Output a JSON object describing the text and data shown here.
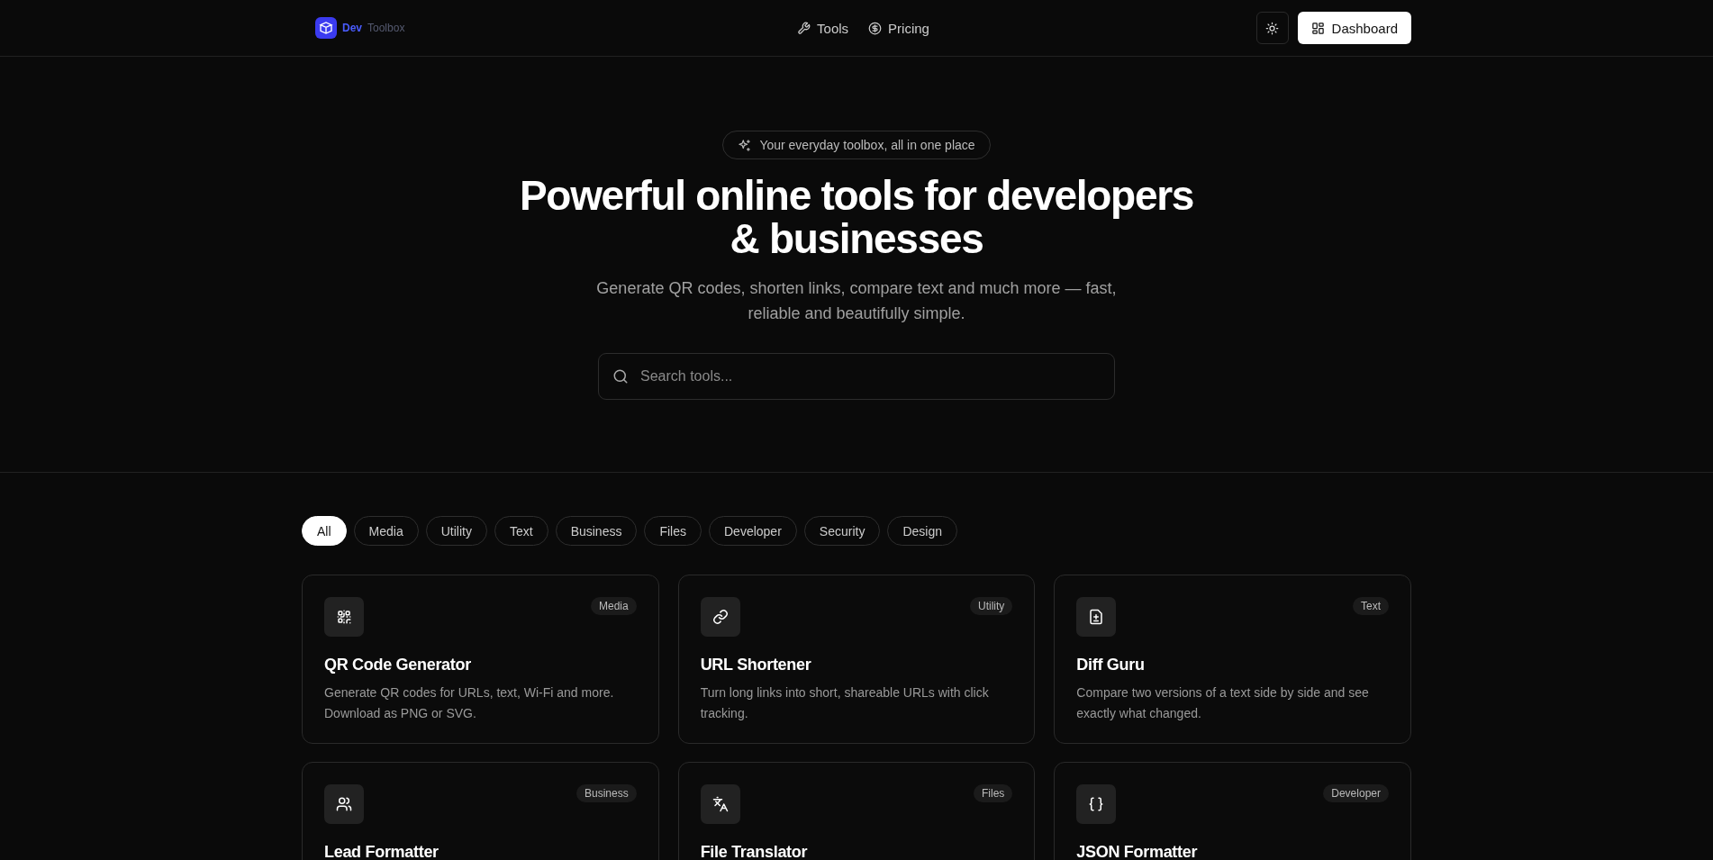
{
  "header": {
    "logo": {
      "primary": "Dev",
      "secondary": "Toolbox"
    },
    "nav": [
      {
        "label": "Tools"
      },
      {
        "label": "Pricing"
      }
    ],
    "dashboard_button": {
      "label": "Dashboard"
    }
  },
  "hero": {
    "badge": "Your everyday toolbox, all in one place",
    "title": "Powerful online tools for developers & businesses",
    "subtitle": "Generate QR codes, shorten links, compare text and much more — fast, reliable and beautifully simple.",
    "search": {
      "placeholder": "Search tools..."
    }
  },
  "categories": [
    {
      "label": "All",
      "selected": true
    },
    {
      "label": "Media",
      "selected": false
    },
    {
      "label": "Utility",
      "selected": false
    },
    {
      "label": "Text",
      "selected": false
    },
    {
      "label": "Business",
      "selected": false
    },
    {
      "label": "Files",
      "selected": false
    },
    {
      "label": "Developer",
      "selected": false
    },
    {
      "label": "Security",
      "selected": false
    },
    {
      "label": "Design",
      "selected": false
    }
  ],
  "tools": [
    {
      "category": "Media",
      "title": "QR Code Generator",
      "description": "Generate QR codes for URLs, text, Wi-Fi and more. Download as PNG or SVG."
    },
    {
      "category": "Utility",
      "title": "URL Shortener",
      "description": "Turn long links into short, shareable URLs with click tracking."
    },
    {
      "category": "Text",
      "title": "Diff Guru",
      "description": "Compare two versions of a text side by side and see exactly what changed."
    },
    {
      "category": "Business",
      "title": "Lead Formatter"
    },
    {
      "category": "Files",
      "title": "File Translator"
    },
    {
      "category": "Developer",
      "title": "JSON Formatter"
    }
  ]
}
